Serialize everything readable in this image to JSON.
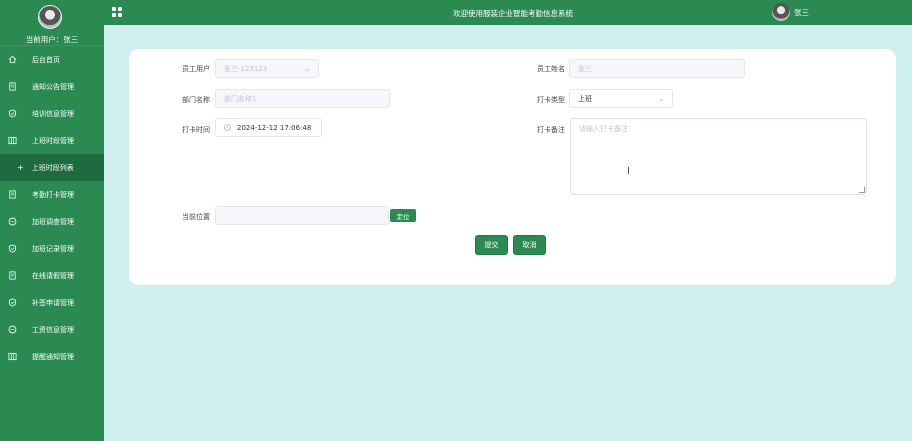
{
  "sidebar": {
    "current_user_label": "当前用户：张三",
    "items": [
      {
        "label": "后台首页",
        "icon": "home-icon"
      },
      {
        "label": "通知公告管理",
        "icon": "document-icon"
      },
      {
        "label": "培训信息管理",
        "icon": "shield-icon"
      },
      {
        "label": "上班时段管理",
        "icon": "columns-icon"
      },
      {
        "label": "上班时段列表",
        "icon": "plus-icon",
        "active": true
      },
      {
        "label": "考勤打卡管理",
        "icon": "document-icon"
      },
      {
        "label": "加班调查管理",
        "icon": "chat-icon"
      },
      {
        "label": "加班记录管理",
        "icon": "shield-icon"
      },
      {
        "label": "在线请假管理",
        "icon": "document-icon"
      },
      {
        "label": "补签申请管理",
        "icon": "shield-icon"
      },
      {
        "label": "工资信息管理",
        "icon": "chat-icon"
      },
      {
        "label": "提醒通知管理",
        "icon": "columns-icon"
      }
    ]
  },
  "header": {
    "title": "欢迎使用服装企业智能考勤信息系统",
    "username": "张三"
  },
  "form": {
    "employee_user_label": "员工用户",
    "employee_user_value": "张三-123123",
    "employee_name_label": "员工姓名",
    "employee_name_value": "张三",
    "department_label": "部门名称",
    "department_value": "部门名称1",
    "punch_type_label": "打卡类型",
    "punch_type_value": "上班",
    "punch_time_label": "打卡时间",
    "punch_time_value": "2024-12-12 17:06:48",
    "remark_label": "打卡备注",
    "remark_placeholder": "请输入打卡备注",
    "location_label": "当前位置",
    "location_value": "",
    "locate_button": "定位",
    "submit_button": "提交",
    "cancel_button": "取消"
  },
  "colors": {
    "primary": "#2a8a52",
    "background": "#cff0ef",
    "active_menu": "#1d6b3f"
  }
}
